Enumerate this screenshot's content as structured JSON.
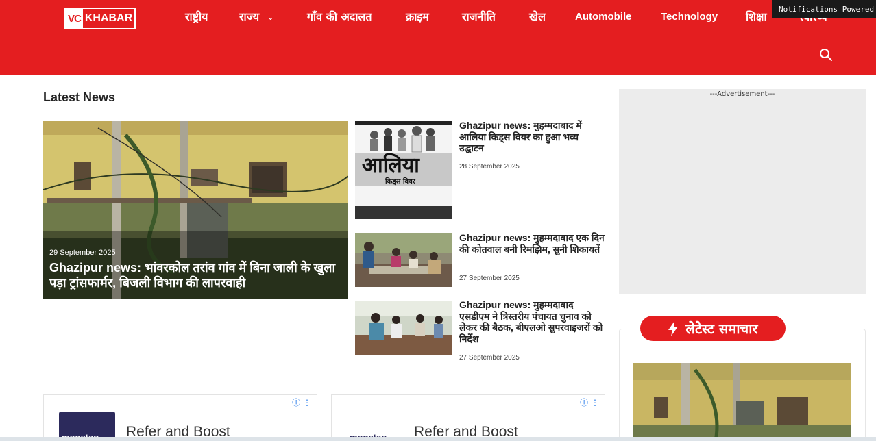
{
  "site": {
    "logo_part1": "VC",
    "logo_part2": "KHABAR",
    "brand_color": "#e41e20"
  },
  "nav": {
    "items": [
      {
        "label": "राष्ट्रीय"
      },
      {
        "label": "राज्य",
        "has_dropdown": true
      },
      {
        "label": "गाँव की अदालत"
      },
      {
        "label": "क्राइम"
      },
      {
        "label": "राजनीति"
      },
      {
        "label": "खेल"
      },
      {
        "label": "Automobile"
      },
      {
        "label": "Technology"
      },
      {
        "label": "शिक्षा"
      },
      {
        "label": "स्वास्थ्य"
      }
    ],
    "search_icon": "search-icon"
  },
  "notification_bar": {
    "text": "Notifications Powered"
  },
  "latest": {
    "heading": "Latest News",
    "hero": {
      "date": "29 September 2025",
      "title": "Ghazipur news: भांवरकोल तरांव गांव में बिना जाली के खुला पड़ा ट्रांसफार्मर, बिजली विभाग की लापरवाही"
    },
    "side": [
      {
        "title": "Ghazipur news: मुहम्मदाबाद में आलिया किड्स वियर का हुआ भव्य उद्घाटन",
        "date": "28 September 2025",
        "thumb_text_big": "आलिया",
        "thumb_text_sub": "किड्स वियर"
      },
      {
        "title": "Ghazipur news: मुहम्मदाबाद एक दिन की कोतवाल बनी रिमझिम, सुनी शिकायतें",
        "date": "27 September 2025"
      },
      {
        "title": "Ghazipur news: मुहम्मदाबाद एसडीएम ने त्रिस्तरीय पंचायत चुनाव को लेकर की बैठक, बीएलओ सुपरवाइजरों को निर्देश",
        "date": "27 September 2025"
      }
    ]
  },
  "sidebar": {
    "ad_label": "---Advertisement---",
    "widget_title": "लेटेस्ट समाचार",
    "widget_icon": "lightning-icon"
  },
  "bottom_ads": [
    {
      "brand": "monetag",
      "headline": "Refer and Boost"
    },
    {
      "brand": "monetag",
      "headline": "Refer and Boost"
    }
  ]
}
